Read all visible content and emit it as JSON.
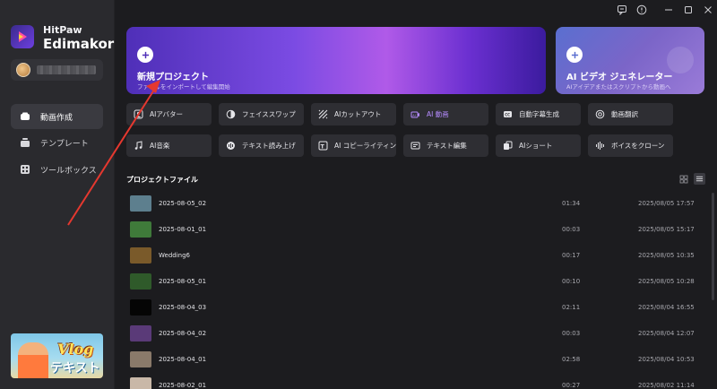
{
  "app": {
    "brand_top": "HitPaw",
    "brand_main": "Edimakor"
  },
  "sidebar": {
    "items": [
      {
        "label": "動画作成",
        "icon": "video-icon",
        "active": true
      },
      {
        "label": "テンプレート",
        "icon": "template-icon",
        "active": false
      },
      {
        "label": "ツールボックス",
        "icon": "toolbox-icon",
        "active": false
      }
    ],
    "banner": {
      "title": "Vlog",
      "subtitle": "テキスト"
    }
  },
  "hero": {
    "new_project": {
      "title": "新規プロジェクト",
      "subtitle": "ファイルをインポートして編集開始"
    },
    "ai_video": {
      "title": "AI ビデオ ジェネレーター",
      "subtitle": "AIアイデアまたはスクリプトから動画へ"
    }
  },
  "tools": [
    {
      "label": "AIアバター",
      "icon": "avatar-icon"
    },
    {
      "label": "フェイススワップ",
      "icon": "face-swap-icon"
    },
    {
      "label": "AIカットアウト",
      "icon": "cutout-icon"
    },
    {
      "label": "AI 動画",
      "icon": "ai-video-icon",
      "active": true
    },
    {
      "label": "自動字幕生成",
      "icon": "cc-icon"
    },
    {
      "label": "動画翻訳",
      "icon": "translate-icon"
    },
    {
      "label": "AI音楽",
      "icon": "music-icon"
    },
    {
      "label": "テキスト読み上げ",
      "icon": "tts-icon"
    },
    {
      "label": "AI コピーライティング",
      "icon": "copywriting-icon"
    },
    {
      "label": "テキスト編集",
      "icon": "text-edit-icon"
    },
    {
      "label": "AIショート",
      "icon": "shorts-icon"
    },
    {
      "label": "ボイスをクローン",
      "icon": "voice-clone-icon"
    }
  ],
  "projects": {
    "heading": "プロジェクトファイル",
    "rows": [
      {
        "name": "2025-08-05_02",
        "duration": "01:34",
        "date": "2025/08/05 17:57",
        "thumb": "#5d7f8e"
      },
      {
        "name": "2025-08-01_01",
        "duration": "00:03",
        "date": "2025/08/05 15:17",
        "thumb": "#3f7a3a"
      },
      {
        "name": "Wedding6",
        "duration": "00:17",
        "date": "2025/08/05 10:35",
        "thumb": "#7a5a2a"
      },
      {
        "name": "2025-08-05_01",
        "duration": "00:10",
        "date": "2025/08/05 10:28",
        "thumb": "#2f5a2a"
      },
      {
        "name": "2025-08-04_03",
        "duration": "02:11",
        "date": "2025/08/04 16:55",
        "thumb": "#050505"
      },
      {
        "name": "2025-08-04_02",
        "duration": "00:03",
        "date": "2025/08/04 12:07",
        "thumb": "#5a3a78"
      },
      {
        "name": "2025-08-04_01",
        "duration": "02:58",
        "date": "2025/08/04 10:53",
        "thumb": "#8a7a6a"
      },
      {
        "name": "2025-08-02_01",
        "duration": "00:27",
        "date": "2025/08/02 11:14",
        "thumb": "#c9b8a8"
      }
    ]
  },
  "colors": {
    "accent": "#7b4be3",
    "annotation": "#e5382f"
  }
}
